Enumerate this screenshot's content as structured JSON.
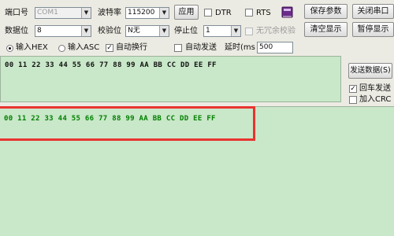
{
  "colors": {
    "window_bg": "#ecebe3",
    "send_area_bg": "#c9e7c9",
    "recv_area_bg": "#c9e7c9",
    "recv_text": "#008000",
    "highlight_box": "#e8332f"
  },
  "port": {
    "label": "端口号",
    "value": "COM1"
  },
  "baud": {
    "label": "波特率",
    "value": "115200"
  },
  "databits": {
    "label": "数据位",
    "value": "8"
  },
  "parity": {
    "label": "校验位",
    "value": "N无"
  },
  "stopbits": {
    "label": "停止位",
    "value": "1"
  },
  "buttons": {
    "apply": "应用",
    "save_params": "保存参数",
    "close_port": "关闭串口",
    "clear_display": "清空显示",
    "pause_display": "暂停显示",
    "send_data": "发送数据(S)"
  },
  "checks": {
    "dtr": "DTR",
    "rts": "RTS",
    "no_parity": "无冗余校验",
    "auto_newline": "自动换行",
    "auto_send": "自动发送",
    "send_newline": "回车发送",
    "add_crc": "加入CRC"
  },
  "input_mode": {
    "hex": "输入HEX",
    "asc": "输入ASC"
  },
  "delay": {
    "label": "延时(ms",
    "value": "500"
  },
  "send_text": "00 11 22 33 44 55 66 77 88 99 AA BB CC DD EE FF",
  "recv_text": "00 11 22 33 44 55 66 77 88 99 AA BB CC DD EE FF"
}
